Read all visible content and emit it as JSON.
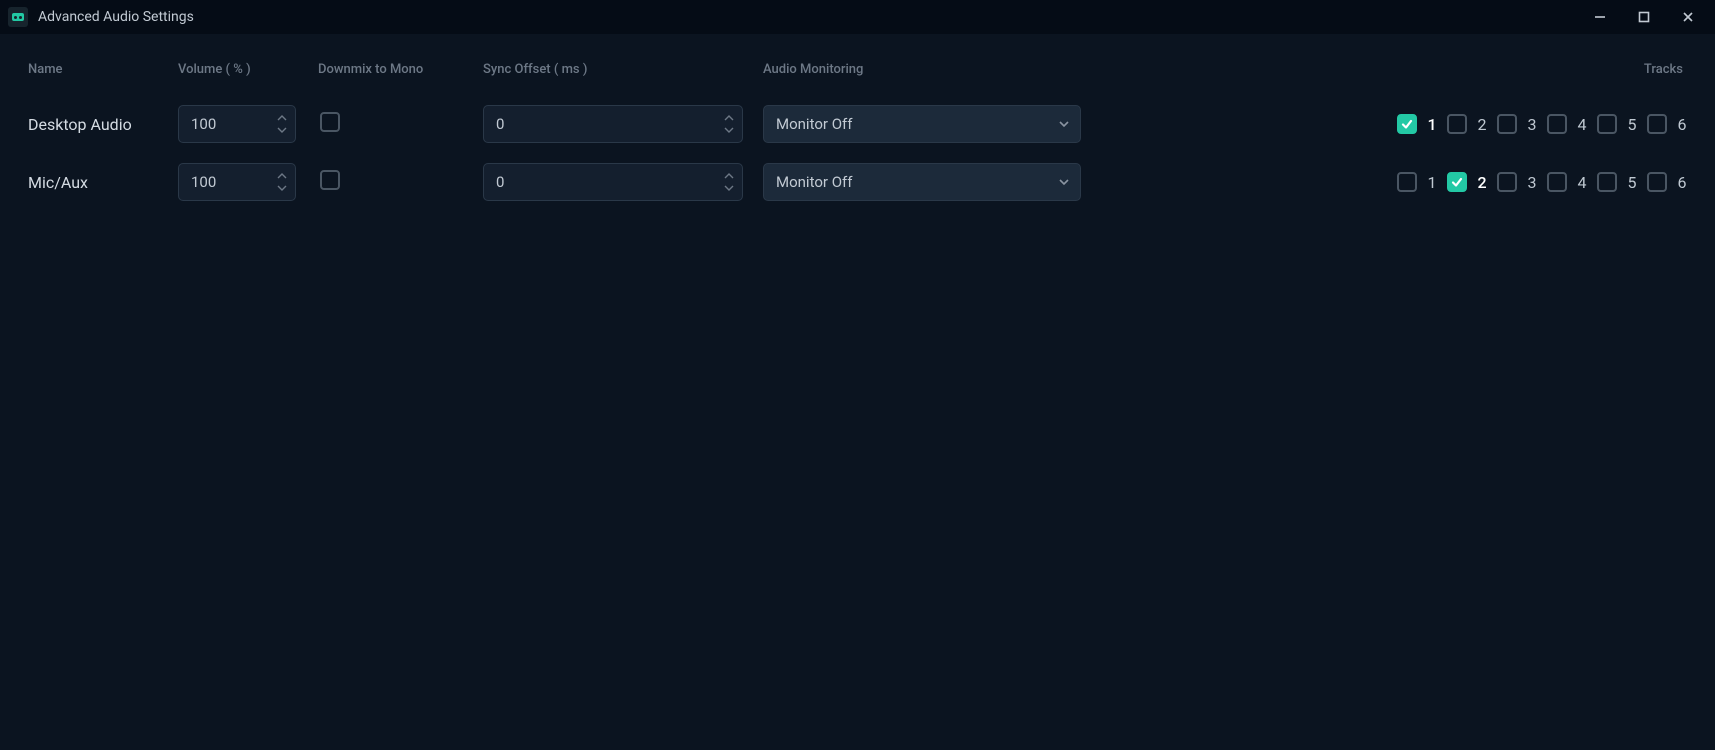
{
  "window": {
    "title": "Advanced Audio Settings"
  },
  "columns": {
    "name": "Name",
    "volume": "Volume ( % )",
    "downmix": "Downmix to Mono",
    "sync_offset": "Sync Offset ( ms )",
    "monitoring": "Audio Monitoring",
    "tracks": "Tracks"
  },
  "track_labels": [
    "1",
    "2",
    "3",
    "4",
    "5",
    "6"
  ],
  "sources": [
    {
      "name": "Desktop Audio",
      "volume": "100",
      "downmix": false,
      "sync_offset": "0",
      "monitoring": "Monitor Off",
      "tracks": [
        true,
        false,
        false,
        false,
        false,
        false
      ]
    },
    {
      "name": "Mic/Aux",
      "volume": "100",
      "downmix": false,
      "sync_offset": "0",
      "monitoring": "Monitor Off",
      "tracks": [
        false,
        true,
        false,
        false,
        false,
        false
      ]
    }
  ]
}
